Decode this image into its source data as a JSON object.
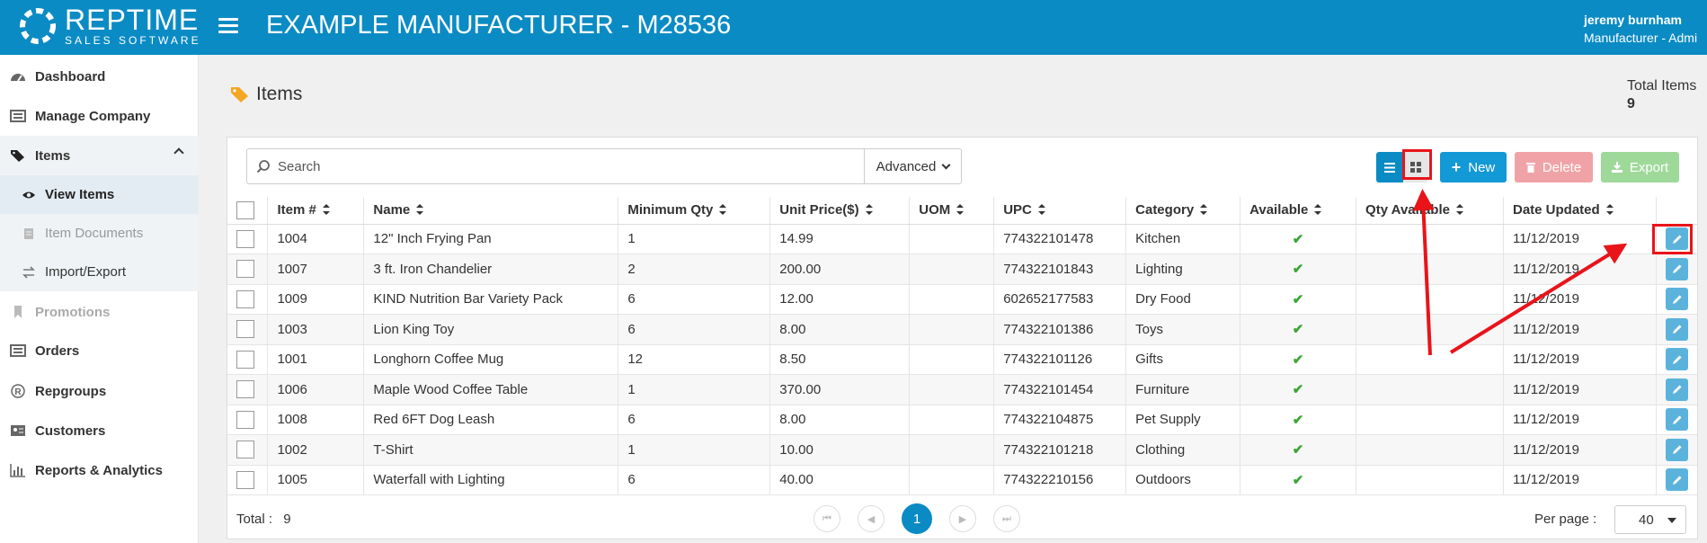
{
  "header": {
    "brand_name": "REPTIME",
    "brand_sub": "SALES SOFTWARE",
    "title": "EXAMPLE MANUFACTURER - M28536",
    "user_name": "jeremy burnham",
    "user_role": "Manufacturer - Admi",
    "color": "#0b8bc4"
  },
  "sidebar": {
    "items": [
      {
        "label": "Dashboard",
        "icon": "dashboard-icon"
      },
      {
        "label": "Manage Company",
        "icon": "company-icon"
      },
      {
        "label": "Items",
        "icon": "tags-icon"
      },
      {
        "label": "View Items",
        "icon": "eye-icon"
      },
      {
        "label": "Item Documents",
        "icon": "document-icon"
      },
      {
        "label": "Import/Export",
        "icon": "exchange-icon"
      },
      {
        "label": "Promotions",
        "icon": "bookmark-icon"
      },
      {
        "label": "Orders",
        "icon": "list-icon"
      },
      {
        "label": "Repgroups",
        "icon": "registered-icon"
      },
      {
        "label": "Customers",
        "icon": "id-card-icon"
      },
      {
        "label": "Reports & Analytics",
        "icon": "bar-chart-icon"
      }
    ]
  },
  "page": {
    "title": "Items",
    "total_label": "Total Items",
    "total_value": "9"
  },
  "toolbar": {
    "search_placeholder": "Search",
    "advanced_label": "Advanced",
    "new_label": "New",
    "delete_label": "Delete",
    "export_label": "Export"
  },
  "table": {
    "headers": [
      "Item #",
      "Name",
      "Minimum Qty",
      "Unit Price($)",
      "UOM",
      "UPC",
      "Category",
      "Available",
      "Qty Available",
      "Date Updated"
    ],
    "rows": [
      [
        "1004",
        "12\" Inch Frying Pan",
        "1",
        "14.99",
        "",
        "774322101478",
        "Kitchen",
        "✔",
        "",
        "11/12/2019"
      ],
      [
        "1007",
        "3 ft. Iron Chandelier",
        "2",
        "200.00",
        "",
        "774322101843",
        "Lighting",
        "✔",
        "",
        "11/12/2019"
      ],
      [
        "1009",
        "KIND Nutrition Bar Variety Pack",
        "6",
        "12.00",
        "",
        "602652177583",
        "Dry Food",
        "✔",
        "",
        "11/12/2019"
      ],
      [
        "1003",
        "Lion King Toy",
        "6",
        "8.00",
        "",
        "774322101386",
        "Toys",
        "✔",
        "",
        "11/12/2019"
      ],
      [
        "1001",
        "Longhorn Coffee Mug",
        "12",
        "8.50",
        "",
        "774322101126",
        "Gifts",
        "✔",
        "",
        "11/12/2019"
      ],
      [
        "1006",
        "Maple Wood Coffee Table",
        "1",
        "370.00",
        "",
        "774322101454",
        "Furniture",
        "✔",
        "",
        "11/12/2019"
      ],
      [
        "1008",
        "Red 6FT Dog Leash",
        "6",
        "8.00",
        "",
        "774322104875",
        "Pet Supply",
        "✔",
        "",
        "11/12/2019"
      ],
      [
        "1002",
        "T-Shirt",
        "1",
        "10.00",
        "",
        "774322101218",
        "Clothing",
        "✔",
        "",
        "11/12/2019"
      ],
      [
        "1005",
        "Waterfall with Lighting",
        "6",
        "40.00",
        "",
        "774322210156",
        "Outdoors",
        "✔",
        "",
        "11/12/2019"
      ]
    ]
  },
  "footer": {
    "total_label": "Total :",
    "total_value": "9",
    "current_page": "1",
    "per_page_label": "Per page :",
    "per_page_value": "40"
  }
}
